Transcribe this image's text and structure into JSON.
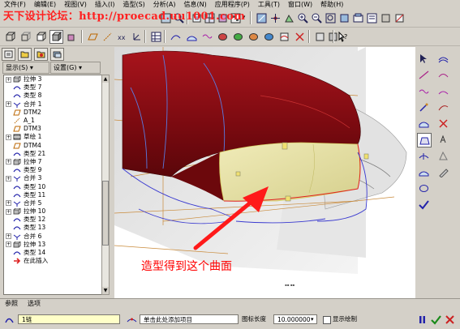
{
  "watermark": "天下设计论坛：http://proecad.uu1001.com",
  "menu": [
    "文件(F)",
    "编辑(E)",
    "视图(V)",
    "插入(I)",
    "造型(S)",
    "分析(A)",
    "信息(N)",
    "应用程序(P)",
    "工具(T)",
    "窗口(W)",
    "帮助(H)"
  ],
  "left_panel": {
    "show_label": "显示(S) ▾",
    "settings_label": "设置(G) ▾"
  },
  "tree_items": [
    {
      "expand": "+",
      "icon": "extrude-icon",
      "label": "拉伸 3"
    },
    {
      "expand": "",
      "icon": "style-icon",
      "label": "类型 7"
    },
    {
      "expand": "",
      "icon": "style-icon",
      "label": "类型 8"
    },
    {
      "expand": "+",
      "icon": "merge-icon",
      "label": "合并 1"
    },
    {
      "expand": "",
      "icon": "datum-plane-icon",
      "label": "DTM2"
    },
    {
      "expand": "",
      "icon": "axis-icon",
      "label": "A_1"
    },
    {
      "expand": "",
      "icon": "datum-plane-icon",
      "label": "DTM3"
    },
    {
      "expand": "+",
      "icon": "sketch-icon",
      "label": "草绘 1"
    },
    {
      "expand": "",
      "icon": "datum-plane-icon",
      "label": "DTM4"
    },
    {
      "expand": "",
      "icon": "style-icon",
      "label": "类型 21"
    },
    {
      "expand": "+",
      "icon": "extrude-icon",
      "label": "拉伸 7"
    },
    {
      "expand": "",
      "icon": "style-icon",
      "label": "类型 9"
    },
    {
      "expand": "+",
      "icon": "merge-icon",
      "label": "合并 3"
    },
    {
      "expand": "",
      "icon": "style-icon",
      "label": "类型 10"
    },
    {
      "expand": "",
      "icon": "style-icon",
      "label": "类型 11"
    },
    {
      "expand": "+",
      "icon": "merge-icon",
      "label": "合并 5"
    },
    {
      "expand": "+",
      "icon": "extrude-icon",
      "label": "拉伸 10"
    },
    {
      "expand": "",
      "icon": "style-icon",
      "label": "类型 12"
    },
    {
      "expand": "",
      "icon": "style-icon",
      "label": "类型 13"
    },
    {
      "expand": "+",
      "icon": "merge-icon",
      "label": "合并 6"
    },
    {
      "expand": "+",
      "icon": "extrude-icon",
      "label": "拉伸 13"
    },
    {
      "expand": "",
      "icon": "style-icon",
      "label": "类型 14"
    },
    {
      "expand": "",
      "icon": "insert-here-icon",
      "label": "在此插入"
    }
  ],
  "annotation": "造型得到这个曲面",
  "dashboard": {
    "tab_refs": "参照",
    "tab_options": "选项",
    "chain_field": "1链",
    "add_item_field": "单击此处添加项目",
    "length_label": "图标长度",
    "length_value": "10.000000",
    "show_plot_label": "显示绘制"
  },
  "colors": {
    "surface_red": "#8a0c12",
    "surface_yellow": "#e8e3a6",
    "arrow_red": "#ff1a1a",
    "watermark_red": "#ff2020"
  }
}
